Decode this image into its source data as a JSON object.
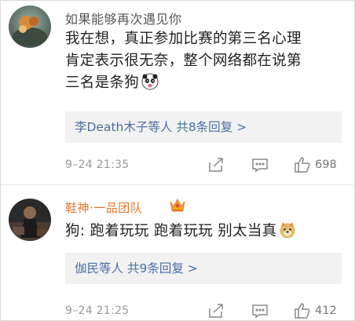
{
  "comments": [
    {
      "username": "如果能够再次遇见你",
      "text_lines": [
        "我在想，真正参加比赛的第三名心理",
        "肯定表示很无奈，整个网络都在说第",
        "三名是条狗"
      ],
      "trailing_emoji": "panda-face-emoji",
      "replies_users": "李Death木子等人",
      "replies_count": "共8条回复 >",
      "time": "9–24 21:35",
      "likes": "698"
    },
    {
      "username": "鞋神·一品团队",
      "badge": "crown-icon",
      "text_lines": [
        "狗: 跑着玩玩 跑着玩玩 别太当真"
      ],
      "trailing_emoji": "doge-face-emoji",
      "replies_users": "伽民等人",
      "replies_count": "共9条回复 >",
      "time": "9–24 21:25",
      "likes": "412"
    }
  ],
  "colors": {
    "username_default": "#555555",
    "username_vip": "#e5772b",
    "reply_link": "#4a6fa5",
    "reply_bg": "#f2f2f2",
    "meta_text": "#999999"
  },
  "icons": [
    "share-icon",
    "comment-icon",
    "like-icon"
  ]
}
